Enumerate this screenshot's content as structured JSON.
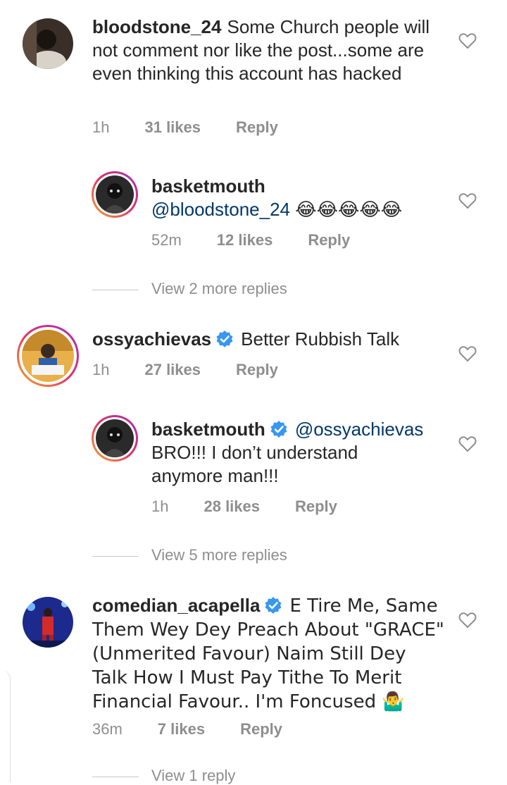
{
  "comments": [
    {
      "username": "bloodstone_24",
      "text": "Some Church people will not comment nor like the post...some are even thinking this account has hacked",
      "time": "1h",
      "likes": "31 likes",
      "reply": "Reply"
    },
    {
      "username": "basketmouth",
      "mention": "@bloodstone_24",
      "text": "😂😂😂😂😂",
      "time": "52m",
      "likes": "12 likes",
      "reply": "Reply"
    },
    {
      "view_more": "View 2 more replies"
    },
    {
      "username": "ossyachievas",
      "text": "Better Rubbish Talk",
      "time": "1h",
      "likes": "27 likes",
      "reply": "Reply"
    },
    {
      "username": "basketmouth",
      "mention": "@ossyachievas",
      "text": "BRO!!! I don’t understand anymore man!!!",
      "time": "1h",
      "likes": "28 likes",
      "reply": "Reply"
    },
    {
      "view_more": "View 5 more replies"
    },
    {
      "username": "comedian_acapella",
      "text": "E Tire Me, Same Them Wey Dey Preach About \"GRACE\" (Unmerited Favour) Naim Still Dey Talk How I Must Pay Tithe To Merit Financial Favour.. I'm Foncused 🤷‍♂️",
      "time": "36m",
      "likes": "7 likes",
      "reply": "Reply"
    },
    {
      "view_more": "View 1 reply"
    }
  ],
  "colors": {
    "verified": "#3897f0",
    "mention": "#00376b",
    "meta": "#8e8e8e"
  }
}
